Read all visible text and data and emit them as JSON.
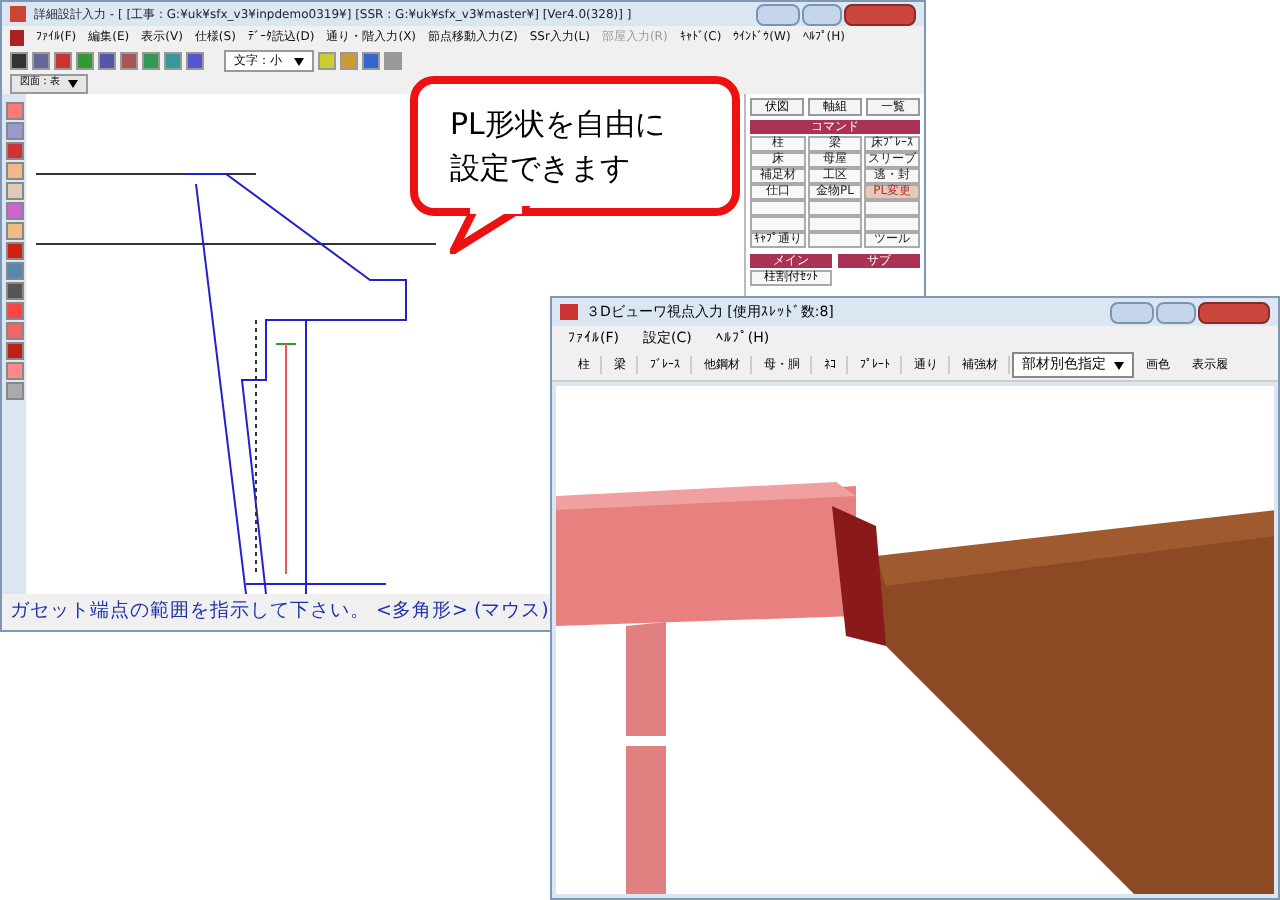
{
  "back_window": {
    "title": "詳細設計入力 - [ [工事 : G:¥uk¥sfx_v3¥inpdemo0319¥] [SSR : G:¥uk¥sfx_v3¥master¥] [Ver4.0(328)] ]",
    "menu": [
      {
        "label": "ﾌｧｲﾙ(F)",
        "disabled": false
      },
      {
        "label": "編集(E)",
        "disabled": false
      },
      {
        "label": "表示(V)",
        "disabled": false
      },
      {
        "label": "仕様(S)",
        "disabled": false
      },
      {
        "label": "ﾃﾞｰﾀ読込(D)",
        "disabled": false
      },
      {
        "label": "通り・階入力(X)",
        "disabled": false
      },
      {
        "label": "節点移動入力(Z)",
        "disabled": false
      },
      {
        "label": "SSr入力(L)",
        "disabled": false
      },
      {
        "label": "部屋入力(R)",
        "disabled": true
      },
      {
        "label": "ｷｬﾄﾞ(C)",
        "disabled": false
      },
      {
        "label": "ｳｲﾝﾄﾞｳ(W)",
        "disabled": false
      },
      {
        "label": "ﾍﾙﾌﾟ(H)",
        "disabled": false
      }
    ],
    "font_combo": "文字：小",
    "view_combo": "図面：表",
    "view_tabs": [
      {
        "label": "伏図",
        "selected": false
      },
      {
        "label": "軸組",
        "selected": false
      },
      {
        "label": "一覧",
        "selected": false
      }
    ],
    "command_header": "コマンド",
    "commands": [
      {
        "label": "柱",
        "selected": false
      },
      {
        "label": "梁",
        "selected": false
      },
      {
        "label": "床ﾌﾞﾚｰｽ",
        "selected": false
      },
      {
        "label": "床",
        "selected": false
      },
      {
        "label": "母屋",
        "selected": false
      },
      {
        "label": "スリーブ",
        "selected": false
      },
      {
        "label": "補足材",
        "selected": false
      },
      {
        "label": "工区",
        "selected": false
      },
      {
        "label": "逃・封",
        "selected": false
      },
      {
        "label": "仕口",
        "selected": false
      },
      {
        "label": "金物PL",
        "selected": false
      },
      {
        "label": "PL変更",
        "selected": true
      },
      {
        "selected": false
      },
      {
        "selected": false
      },
      {
        "selected": false
      },
      {
        "selected": false
      },
      {
        "selected": false
      },
      {
        "selected": false
      },
      {
        "label": "ｷｬﾌﾟ通り",
        "selected": false
      },
      {
        "selected": false
      },
      {
        "label": "ツール",
        "selected": false
      }
    ],
    "main_header": "メイン",
    "sub_header": "サブ",
    "main_button": "柱割付ｾｯﾄ",
    "status": "ガセット端点の範囲を指示して下さい。 <多角形> (マウス)"
  },
  "callout": {
    "lines": [
      "PL形状を自由に",
      "設定できます"
    ]
  },
  "front_window": {
    "title": "３Dビューワ視点入力 [使用ｽﾚｯﾄﾞ数:8]",
    "menu": [
      "ﾌｧｲﾙ(F)",
      "設定(C)",
      "ﾍﾙﾌﾟ(H)"
    ],
    "tools": [
      "柱",
      "梁",
      "ﾌﾞﾚｰｽ",
      "他鋼材",
      "母・胴",
      "ﾈｺ",
      "ﾌﾟﾚｰﾄ",
      "通り",
      "補強材"
    ],
    "color_select": "部材別色指定",
    "tools_right": [
      "画色",
      "表示履"
    ]
  }
}
